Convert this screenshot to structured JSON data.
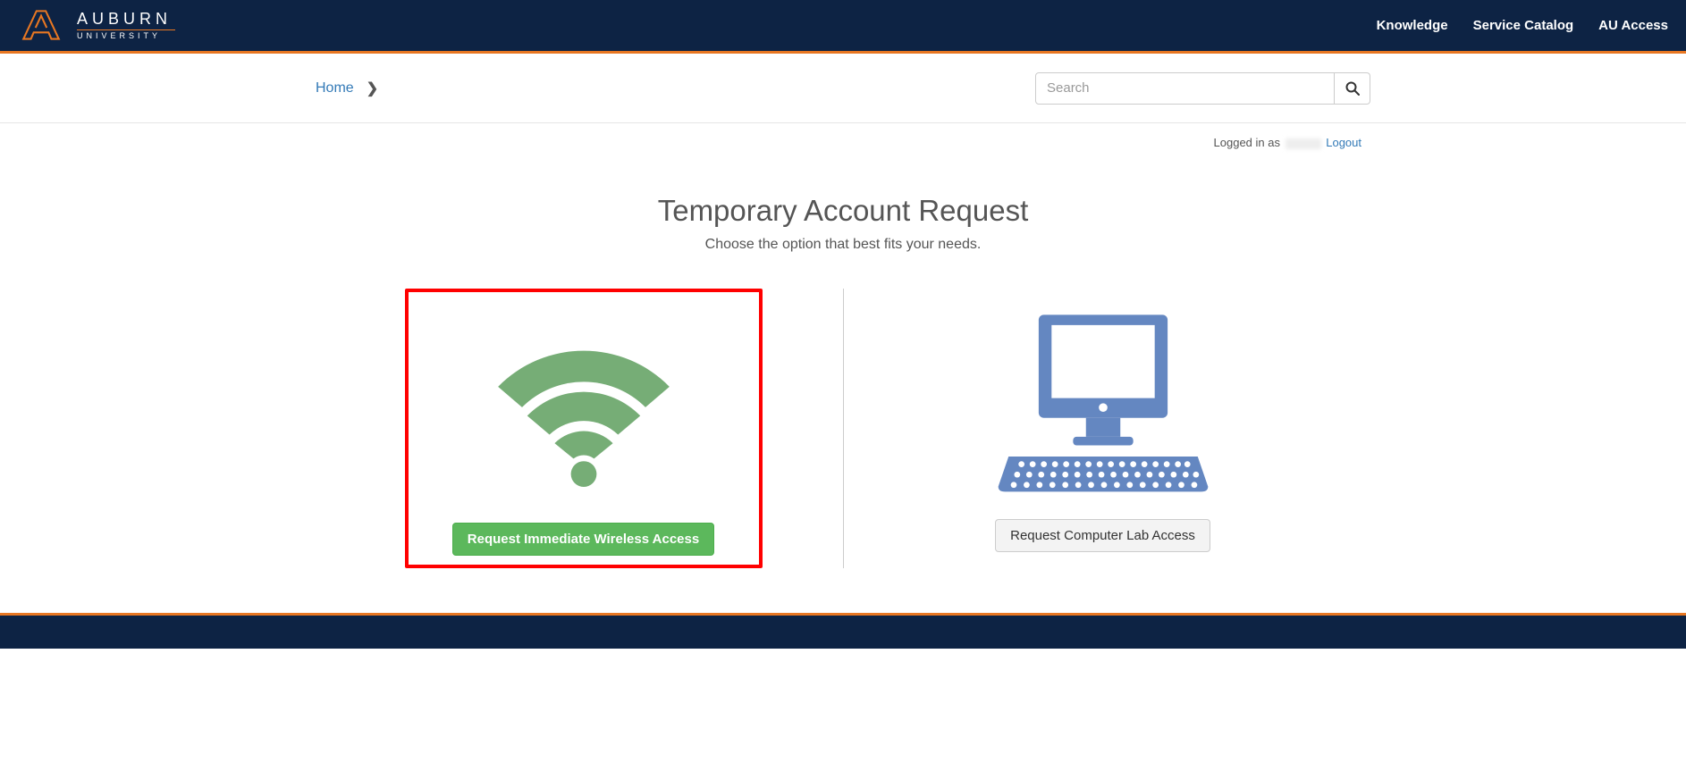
{
  "brand": {
    "name": "AUBURN",
    "subname": "UNIVERSITY"
  },
  "nav": {
    "knowledge": "Knowledge",
    "service_catalog": "Service Catalog",
    "au_access": "AU Access"
  },
  "breadcrumb": {
    "home": "Home"
  },
  "search": {
    "placeholder": "Search"
  },
  "user": {
    "prefix": "Logged in as ",
    "logout": "Logout"
  },
  "page": {
    "title": "Temporary Account Request",
    "subtitle": "Choose the option that best fits your needs."
  },
  "options": {
    "wireless": {
      "button": "Request Immediate Wireless Access",
      "icon": "wifi-icon"
    },
    "lab": {
      "button": "Request Computer Lab Access",
      "icon": "computer-icon"
    }
  },
  "colors": {
    "navy": "#0d2344",
    "orange": "#e87722",
    "green": "#5cb85c",
    "wifi_green": "#76ad76",
    "computer_blue": "#6487c1",
    "highlight_red": "#ff0000"
  }
}
